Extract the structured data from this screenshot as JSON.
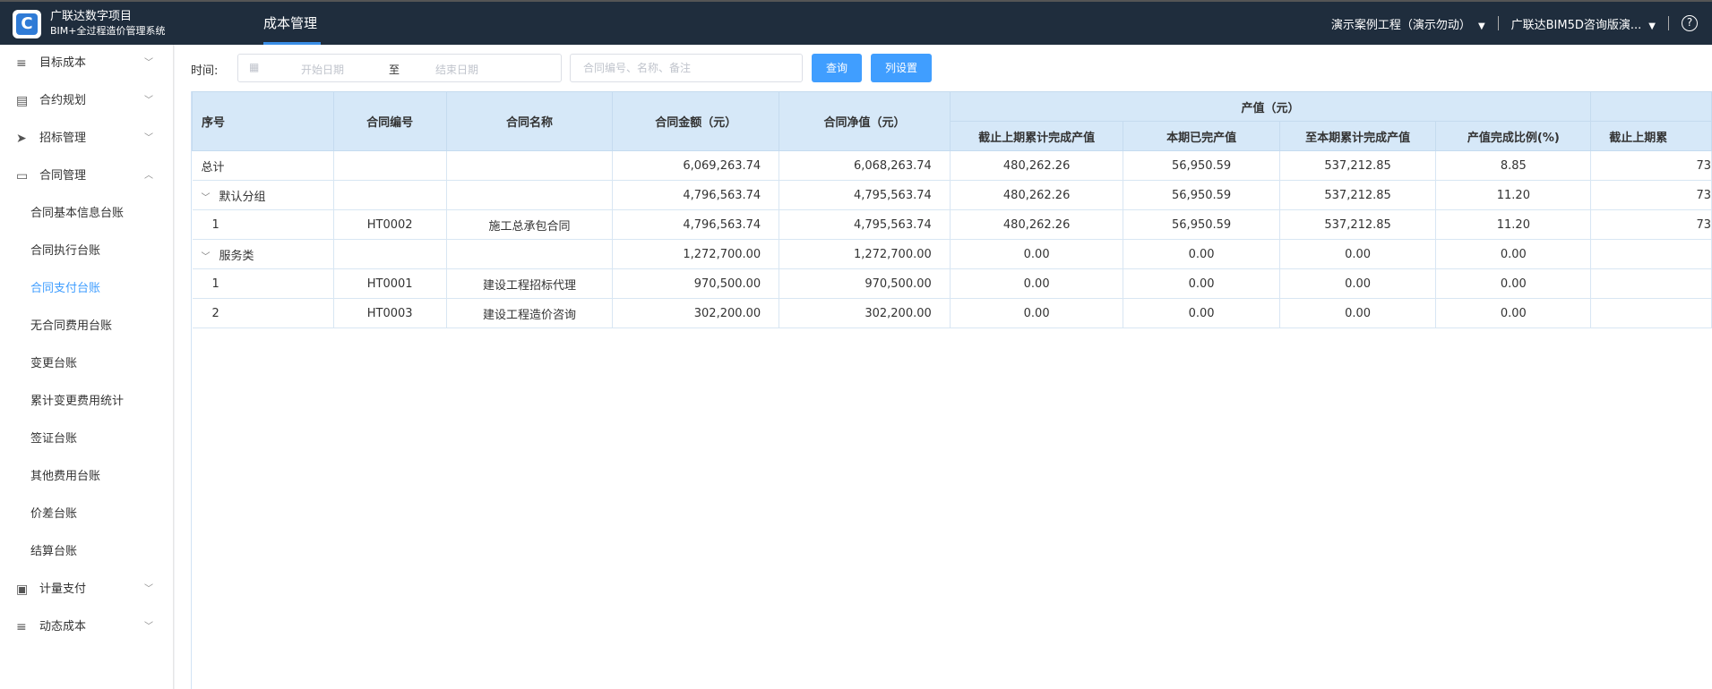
{
  "header": {
    "brand_line1": "广联达数字项目",
    "brand_line2": "BIM+全过程造价管理系统",
    "nav_title": "成本管理",
    "project_select": "演示案例工程（演示勿动）",
    "org_select": "广联达BIM5D咨询版演...",
    "help_glyph": "?",
    "accent": "#3a8ee6",
    "bar_color": "#1f2d3d"
  },
  "sidebar": {
    "menu": [
      {
        "label": "目标成本",
        "icon": "database-icon",
        "glyph": "≡",
        "expanded": false
      },
      {
        "label": "合约规划",
        "icon": "document-icon",
        "glyph": "▤",
        "expanded": false
      },
      {
        "label": "招标管理",
        "icon": "send-icon",
        "glyph": "➤",
        "expanded": false
      },
      {
        "label": "合同管理",
        "icon": "folder-icon",
        "glyph": "▭",
        "expanded": true
      }
    ],
    "sub_items": [
      {
        "label": "合同基本信息台账"
      },
      {
        "label": "合同执行台账"
      },
      {
        "label": "合同支付台账",
        "active": true
      },
      {
        "label": "无合同费用台账"
      },
      {
        "label": "变更台账"
      },
      {
        "label": "累计变更费用统计"
      },
      {
        "label": "签证台账"
      },
      {
        "label": "其他费用台账"
      },
      {
        "label": "价差台账"
      },
      {
        "label": "结算台账"
      }
    ],
    "menu_bottom": [
      {
        "label": "计量支付",
        "icon": "briefcase-icon",
        "glyph": "▣"
      },
      {
        "label": "动态成本",
        "icon": "database-icon",
        "glyph": "≡"
      }
    ],
    "active_color": "#409eff"
  },
  "filter": {
    "time_label": "时间:",
    "start_placeholder": "开始日期",
    "to_label": "至",
    "end_placeholder": "结束日期",
    "search_placeholder": "合同编号、名称、备注",
    "query_button": "查询",
    "columns_button": "列设置"
  },
  "table": {
    "headers": {
      "seq": "序号",
      "code": "合同编号",
      "name": "合同名称",
      "amount": "合同金额（元）",
      "net": "合同净值（元）",
      "output_group": "产值（元）",
      "prev_cum": "截止上期累计完成产值",
      "cur": "本期已完产值",
      "cum": "至本期累计完成产值",
      "ratio": "产值完成比例(%)",
      "next_prev_cum": "截止上期累"
    },
    "rows": [
      {
        "type": "total",
        "seq": "总计",
        "code": "",
        "name": "",
        "amount": "6,069,263.74",
        "net": "6,068,263.74",
        "prev_cum": "480,262.26",
        "cur": "56,950.59",
        "cum": "537,212.85",
        "ratio": "8.85",
        "extra": "73"
      },
      {
        "type": "group",
        "seq": "默认分组",
        "code": "",
        "name": "",
        "amount": "4,796,563.74",
        "net": "4,795,563.74",
        "prev_cum": "480,262.26",
        "cur": "56,950.59",
        "cum": "537,212.85",
        "ratio": "11.20",
        "extra": "73"
      },
      {
        "type": "item",
        "seq": "1",
        "code": "HT0002",
        "name": "施工总承包合同",
        "amount": "4,796,563.74",
        "net": "4,795,563.74",
        "prev_cum": "480,262.26",
        "cur": "56,950.59",
        "cum": "537,212.85",
        "ratio": "11.20",
        "extra": "73"
      },
      {
        "type": "group",
        "seq": "服务类",
        "code": "",
        "name": "",
        "amount": "1,272,700.00",
        "net": "1,272,700.00",
        "prev_cum": "0.00",
        "cur": "0.00",
        "cum": "0.00",
        "ratio": "0.00",
        "extra": ""
      },
      {
        "type": "item",
        "seq": "1",
        "code": "HT0001",
        "name": "建设工程招标代理",
        "amount": "970,500.00",
        "net": "970,500.00",
        "prev_cum": "0.00",
        "cur": "0.00",
        "cum": "0.00",
        "ratio": "0.00",
        "extra": ""
      },
      {
        "type": "item",
        "seq": "2",
        "code": "HT0003",
        "name": "建设工程造价咨询",
        "amount": "302,200.00",
        "net": "302,200.00",
        "prev_cum": "0.00",
        "cur": "0.00",
        "cum": "0.00",
        "ratio": "0.00",
        "extra": ""
      }
    ]
  }
}
